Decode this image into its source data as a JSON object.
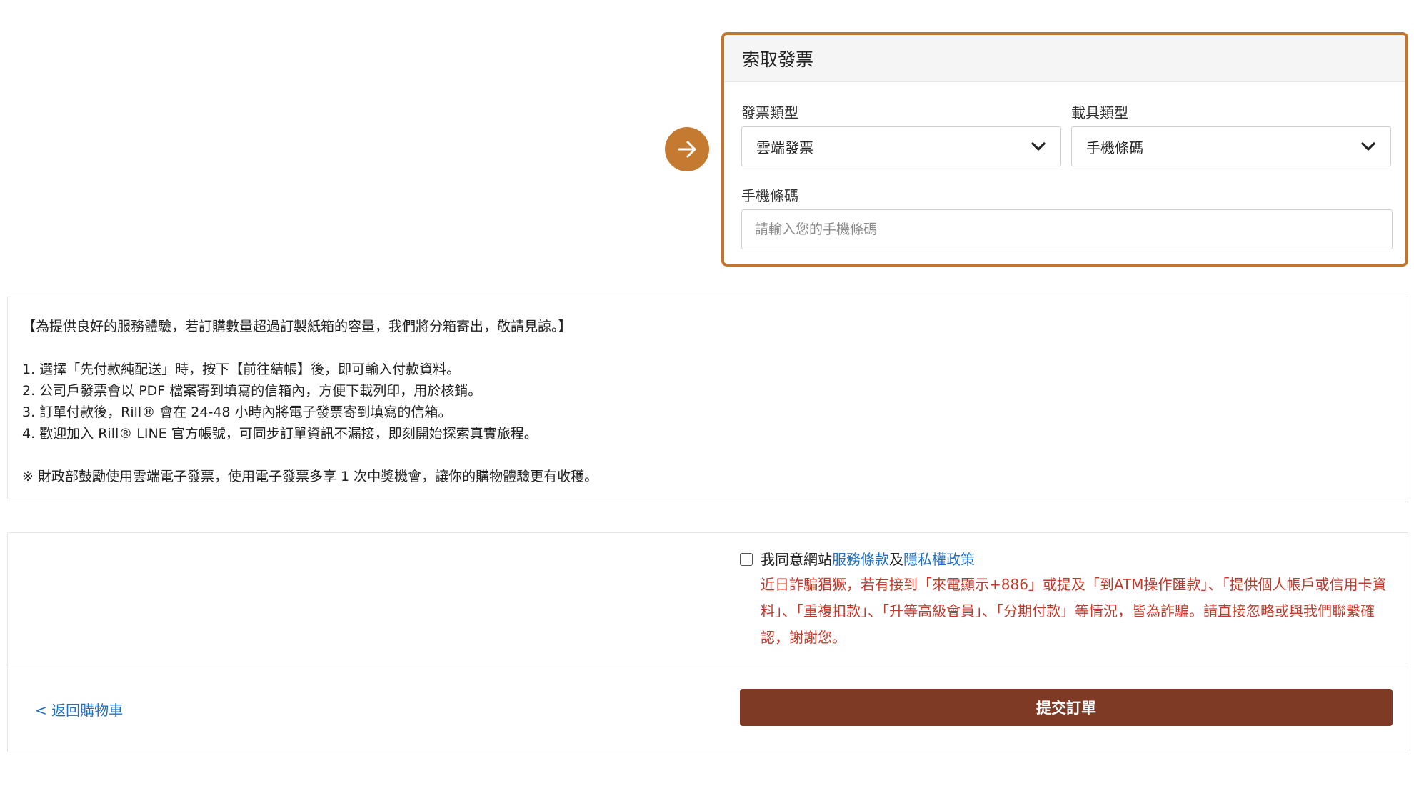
{
  "invoice": {
    "title": "索取發票",
    "invoice_type": {
      "label": "發票類型",
      "selected": "雲端發票"
    },
    "carrier_type": {
      "label": "載具類型",
      "selected": "手機條碼"
    },
    "mobile_barcode": {
      "label": "手機條碼",
      "value": "",
      "placeholder": "請輸入您的手機條碼"
    }
  },
  "notes": {
    "headline": "【為提供良好的服務體驗，若訂購數量超過訂製紙箱的容量，我們將分箱寄出，敬請見諒。】",
    "items": [
      "1. 選擇「先付款純配送」時，按下【前往結帳】後，即可輸入付款資料。",
      "2. 公司戶發票會以 PDF 檔案寄到填寫的信箱內，方便下載列印，用於核銷。",
      "3. 訂單付款後，Rill® 會在 24-48 小時內將電子發票寄到填寫的信箱。",
      "4. 歡迎加入 Rill® LINE 官方帳號，可同步訂單資訊不漏接，即刻開始探索真實旅程。"
    ],
    "footnote": "※ 財政部鼓勵使用雲端電子發票，使用電子發票多享 1 次中獎機會，讓你的購物體驗更有收穫。"
  },
  "agreement": {
    "checked": false,
    "prefix": "我同意網站",
    "terms_link": "服務條款",
    "conjunction": "及",
    "privacy_link": "隱私權政策",
    "warning": "近日詐騙猖獗，若有接到「來電顯示+886」或提及「到ATM操作匯款」、「提供個人帳戶或信用卡資料」、「重複扣款」、「升等高級會員」、「分期付款」等情況，皆為詐騙。請直接忽略或與我們聯繫確認，謝謝您。"
  },
  "actions": {
    "back_label": "< 返回購物車",
    "submit_label": "提交訂單"
  },
  "colors": {
    "accent_orange": "#c47a30",
    "card_border": "#c0762d",
    "submit_bg": "#7e3a24",
    "link": "#1f6fc4",
    "warning_text": "#c0392b"
  },
  "icons": {
    "arrow_badge": "arrow-right-icon",
    "select_chevron": "chevron-down-icon"
  }
}
